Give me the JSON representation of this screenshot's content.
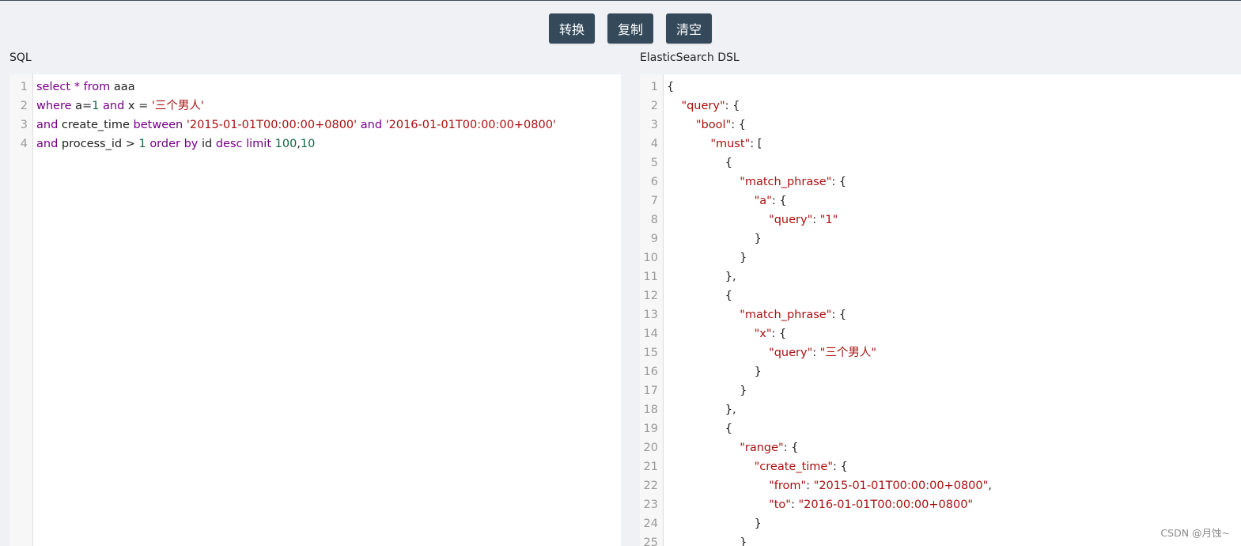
{
  "toolbar": {
    "convert_label": "转换",
    "copy_label": "复制",
    "clear_label": "清空"
  },
  "sql_pane": {
    "label": "SQL",
    "lines": [
      [
        {
          "t": "select",
          "c": "kw"
        },
        {
          "t": " ",
          "c": "id"
        },
        {
          "t": "*",
          "c": "kw"
        },
        {
          "t": " ",
          "c": "id"
        },
        {
          "t": "from",
          "c": "kw"
        },
        {
          "t": " aaa",
          "c": "id"
        }
      ],
      [
        {
          "t": "where",
          "c": "kw"
        },
        {
          "t": " a=",
          "c": "id"
        },
        {
          "t": "1",
          "c": "num"
        },
        {
          "t": " ",
          "c": "id"
        },
        {
          "t": "and",
          "c": "kw"
        },
        {
          "t": " x = ",
          "c": "id"
        },
        {
          "t": "'三个男人'",
          "c": "str"
        }
      ],
      [
        {
          "t": "and",
          "c": "kw"
        },
        {
          "t": " create_time ",
          "c": "id"
        },
        {
          "t": "between",
          "c": "kw"
        },
        {
          "t": " ",
          "c": "id"
        },
        {
          "t": "'2015-01-01T00:00:00+0800'",
          "c": "str"
        },
        {
          "t": " ",
          "c": "id"
        },
        {
          "t": "and",
          "c": "kw"
        },
        {
          "t": " ",
          "c": "id"
        },
        {
          "t": "'2016-01-01T00:00:00+0800'",
          "c": "str"
        }
      ],
      [
        {
          "t": "and",
          "c": "kw"
        },
        {
          "t": " process_id > ",
          "c": "id"
        },
        {
          "t": "1",
          "c": "num"
        },
        {
          "t": " ",
          "c": "id"
        },
        {
          "t": "order",
          "c": "kw"
        },
        {
          "t": " ",
          "c": "id"
        },
        {
          "t": "by",
          "c": "kw"
        },
        {
          "t": " id ",
          "c": "id"
        },
        {
          "t": "desc",
          "c": "kw"
        },
        {
          "t": " ",
          "c": "id"
        },
        {
          "t": "limit",
          "c": "kw"
        },
        {
          "t": " ",
          "c": "id"
        },
        {
          "t": "100",
          "c": "num"
        },
        {
          "t": ",",
          "c": "id"
        },
        {
          "t": "10",
          "c": "num"
        }
      ]
    ]
  },
  "dsl_pane": {
    "label": "ElasticSearch DSL",
    "lines": [
      [
        {
          "t": "{",
          "c": "punc"
        }
      ],
      [
        {
          "t": "    ",
          "c": "punc"
        },
        {
          "t": "\"query\"",
          "c": "key"
        },
        {
          "t": ": {",
          "c": "punc"
        }
      ],
      [
        {
          "t": "        ",
          "c": "punc"
        },
        {
          "t": "\"bool\"",
          "c": "key"
        },
        {
          "t": ": {",
          "c": "punc"
        }
      ],
      [
        {
          "t": "            ",
          "c": "punc"
        },
        {
          "t": "\"must\"",
          "c": "key"
        },
        {
          "t": ": [",
          "c": "punc"
        }
      ],
      [
        {
          "t": "                {",
          "c": "punc"
        }
      ],
      [
        {
          "t": "                    ",
          "c": "punc"
        },
        {
          "t": "\"match_phrase\"",
          "c": "key"
        },
        {
          "t": ": {",
          "c": "punc"
        }
      ],
      [
        {
          "t": "                        ",
          "c": "punc"
        },
        {
          "t": "\"a\"",
          "c": "key"
        },
        {
          "t": ": {",
          "c": "punc"
        }
      ],
      [
        {
          "t": "                            ",
          "c": "punc"
        },
        {
          "t": "\"query\"",
          "c": "key"
        },
        {
          "t": ": ",
          "c": "punc"
        },
        {
          "t": "\"1\"",
          "c": "str"
        }
      ],
      [
        {
          "t": "                        }",
          "c": "punc"
        }
      ],
      [
        {
          "t": "                    }",
          "c": "punc"
        }
      ],
      [
        {
          "t": "                },",
          "c": "punc"
        }
      ],
      [
        {
          "t": "                {",
          "c": "punc"
        }
      ],
      [
        {
          "t": "                    ",
          "c": "punc"
        },
        {
          "t": "\"match_phrase\"",
          "c": "key"
        },
        {
          "t": ": {",
          "c": "punc"
        }
      ],
      [
        {
          "t": "                        ",
          "c": "punc"
        },
        {
          "t": "\"x\"",
          "c": "key"
        },
        {
          "t": ": {",
          "c": "punc"
        }
      ],
      [
        {
          "t": "                            ",
          "c": "punc"
        },
        {
          "t": "\"query\"",
          "c": "key"
        },
        {
          "t": ": ",
          "c": "punc"
        },
        {
          "t": "\"三个男人\"",
          "c": "str"
        }
      ],
      [
        {
          "t": "                        }",
          "c": "punc"
        }
      ],
      [
        {
          "t": "                    }",
          "c": "punc"
        }
      ],
      [
        {
          "t": "                },",
          "c": "punc"
        }
      ],
      [
        {
          "t": "                {",
          "c": "punc"
        }
      ],
      [
        {
          "t": "                    ",
          "c": "punc"
        },
        {
          "t": "\"range\"",
          "c": "key"
        },
        {
          "t": ": {",
          "c": "punc"
        }
      ],
      [
        {
          "t": "                        ",
          "c": "punc"
        },
        {
          "t": "\"create_time\"",
          "c": "key"
        },
        {
          "t": ": {",
          "c": "punc"
        }
      ],
      [
        {
          "t": "                            ",
          "c": "punc"
        },
        {
          "t": "\"from\"",
          "c": "key"
        },
        {
          "t": ": ",
          "c": "punc"
        },
        {
          "t": "\"2015-01-01T00:00:00+0800\"",
          "c": "str"
        },
        {
          "t": ",",
          "c": "punc"
        }
      ],
      [
        {
          "t": "                            ",
          "c": "punc"
        },
        {
          "t": "\"to\"",
          "c": "key"
        },
        {
          "t": ": ",
          "c": "punc"
        },
        {
          "t": "\"2016-01-01T00:00:00+0800\"",
          "c": "str"
        }
      ],
      [
        {
          "t": "                        }",
          "c": "punc"
        }
      ],
      [
        {
          "t": "                    }",
          "c": "punc"
        }
      ]
    ]
  },
  "watermark": "CSDN @月蚀~"
}
